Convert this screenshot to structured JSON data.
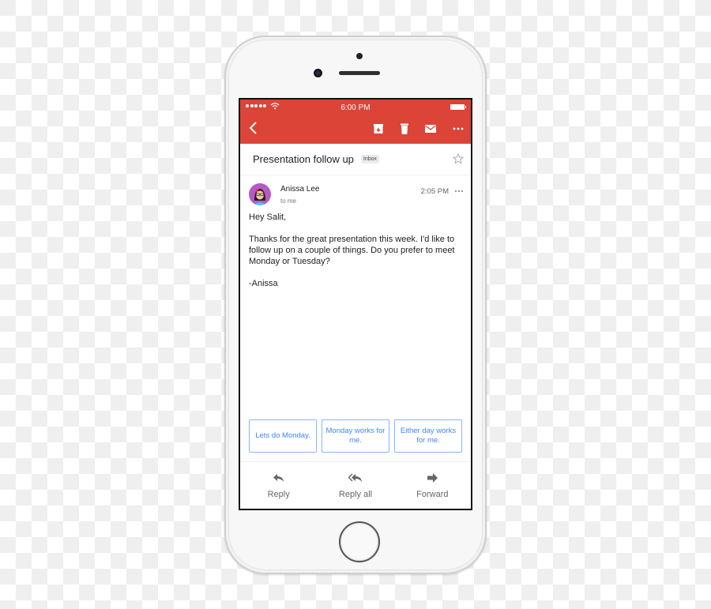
{
  "status_bar": {
    "time": "6:00 PM",
    "signal_bars": 5
  },
  "toolbar": {
    "back_icon": "chevron-left-icon",
    "icons": [
      "archive-icon",
      "trash-icon",
      "mail-icon",
      "more-horizontal-icon"
    ]
  },
  "email": {
    "subject": "Presentation follow up",
    "label": "Inbox",
    "sender": "Anissa Lee",
    "recipient": "to me",
    "time": "2:05 PM",
    "body": [
      "Hey Salit,",
      "Thanks for the great presentation this week. I'd like to follow up on a couple of things. Do you prefer to meet Monday or Tuesday?",
      "-Anissa"
    ]
  },
  "smart_replies": [
    "Lets do Monday.",
    "Monday works for me.",
    "Either day works for me."
  ],
  "actions": [
    {
      "label": "Reply",
      "icon": "reply-icon"
    },
    {
      "label": "Reply all",
      "icon": "reply-all-icon"
    },
    {
      "label": "Forward",
      "icon": "forward-icon"
    }
  ],
  "colors": {
    "appbar": "#db4437",
    "smart_reply_text": "#4285f4",
    "smart_reply_border": "#8ab4f8",
    "avatar_bg": "#b45bc7"
  }
}
